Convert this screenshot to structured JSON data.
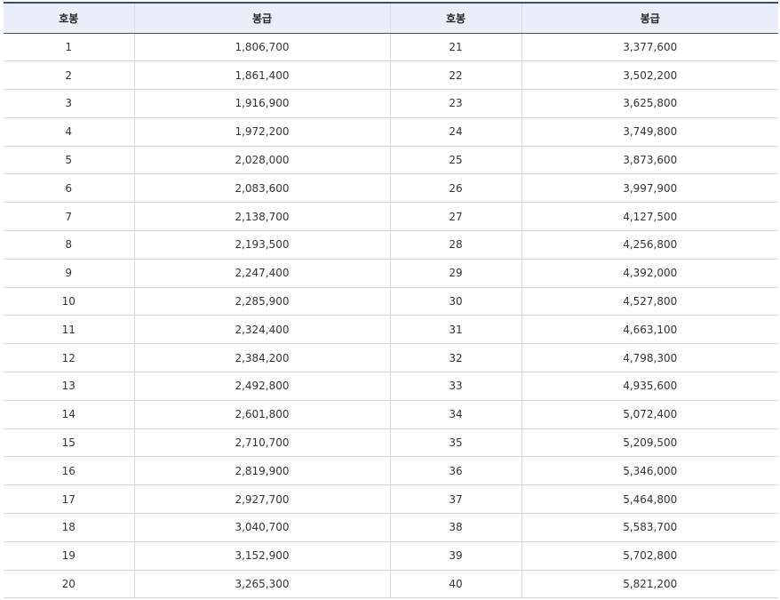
{
  "table": {
    "headers": [
      "호봉",
      "봉급",
      "호봉",
      "봉급"
    ],
    "rows": [
      [
        "1",
        "1,806,700",
        "21",
        "3,377,600"
      ],
      [
        "2",
        "1,861,400",
        "22",
        "3,502,200"
      ],
      [
        "3",
        "1,916,900",
        "23",
        "3,625,800"
      ],
      [
        "4",
        "1,972,200",
        "24",
        "3,749,800"
      ],
      [
        "5",
        "2,028,000",
        "25",
        "3,873,600"
      ],
      [
        "6",
        "2,083,600",
        "26",
        "3,997,900"
      ],
      [
        "7",
        "2,138,700",
        "27",
        "4,127,500"
      ],
      [
        "8",
        "2,193,500",
        "28",
        "4,256,800"
      ],
      [
        "9",
        "2,247,400",
        "29",
        "4,392,000"
      ],
      [
        "10",
        "2,285,900",
        "30",
        "4,527,800"
      ],
      [
        "11",
        "2,324,400",
        "31",
        "4,663,100"
      ],
      [
        "12",
        "2,384,200",
        "32",
        "4,798,300"
      ],
      [
        "13",
        "2,492,800",
        "33",
        "4,935,600"
      ],
      [
        "14",
        "2,601,800",
        "34",
        "5,072,400"
      ],
      [
        "15",
        "2,710,700",
        "35",
        "5,209,500"
      ],
      [
        "16",
        "2,819,900",
        "36",
        "5,346,000"
      ],
      [
        "17",
        "2,927,700",
        "37",
        "5,464,800"
      ],
      [
        "18",
        "3,040,700",
        "38",
        "5,583,700"
      ],
      [
        "19",
        "3,152,900",
        "39",
        "5,702,800"
      ],
      [
        "20",
        "3,265,300",
        "40",
        "5,821,200"
      ]
    ]
  },
  "colors": {
    "header_background": "#e9eef8",
    "header_border": "#3a4d7c",
    "grid_line": "#d7d7d7"
  }
}
